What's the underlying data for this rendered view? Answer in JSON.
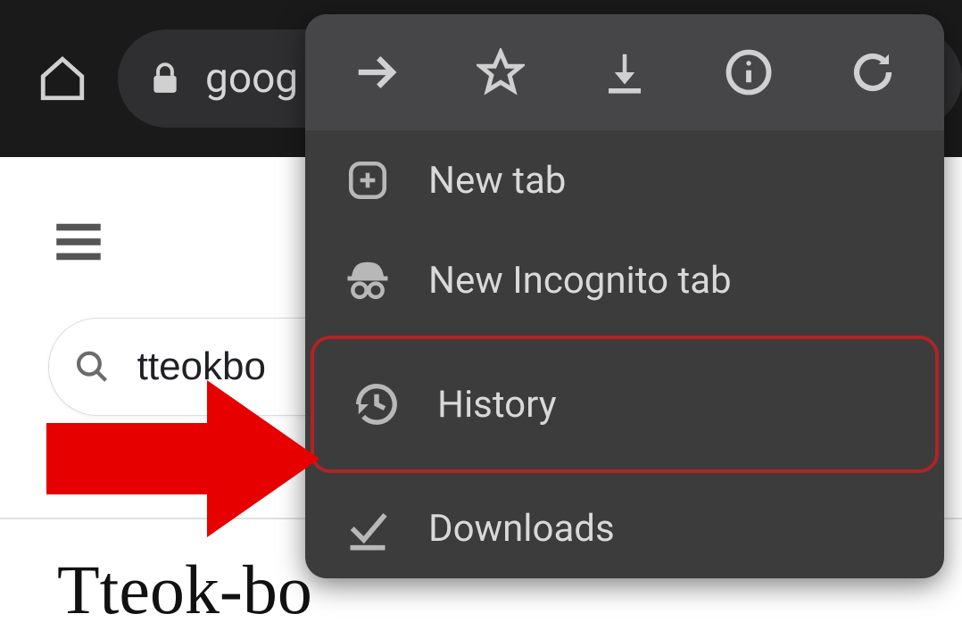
{
  "topbar": {
    "omnibox_text": "goog"
  },
  "page": {
    "search_value": "tteokbo",
    "heading": "Tteok-bo"
  },
  "menu": {
    "items": [
      {
        "label": "New tab"
      },
      {
        "label": "New Incognito tab"
      },
      {
        "label": "History"
      },
      {
        "label": "Downloads"
      }
    ]
  }
}
